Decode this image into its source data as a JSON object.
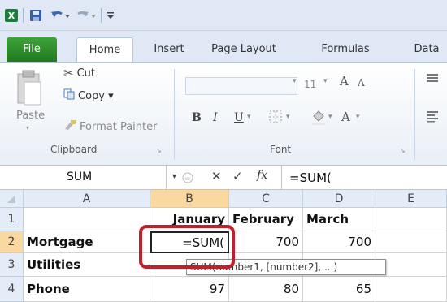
{
  "qat": {
    "app_icon": "excel-icon",
    "save_icon": "save-icon",
    "undo_icon": "undo-icon",
    "redo_icon": "redo-icon",
    "customize_icon": "customize-qat-icon"
  },
  "tabs": [
    "File",
    "Home",
    "Insert",
    "Page Layout",
    "Formulas",
    "Data"
  ],
  "ribbon": {
    "clipboard": {
      "paste_label": "Paste",
      "cut_label": "Cut",
      "copy_label": "Copy ▾",
      "format_painter_label": "Format Painter",
      "group_label": "Clipboard"
    },
    "font": {
      "size": "11",
      "bold": "B",
      "italic": "I",
      "underline": "U",
      "grow": "A",
      "shrink": "A",
      "font_color": "A",
      "group_label": "Font"
    }
  },
  "formula_bar": {
    "name_box": "SUM",
    "cancel": "✕",
    "enter": "✓",
    "fx": "fx",
    "formula": "=SUM("
  },
  "grid": {
    "columns": [
      "A",
      "B",
      "C",
      "D",
      "E"
    ],
    "selected_column": "B",
    "rows": [
      {
        "num": "1",
        "a": "",
        "b": "January",
        "c": "February",
        "d": "March"
      },
      {
        "num": "2",
        "a": "Mortgage",
        "b": "=SUM(",
        "c": "700",
        "d": "700"
      },
      {
        "num": "3",
        "a": "Utilities",
        "b": "",
        "c": "",
        "d": ""
      },
      {
        "num": "4",
        "a": "Phone",
        "b": "97",
        "c": "80",
        "d": "65"
      }
    ],
    "tooltip": "SUM(number1, [number2], ...)",
    "highlight_color": "#c0202a"
  }
}
